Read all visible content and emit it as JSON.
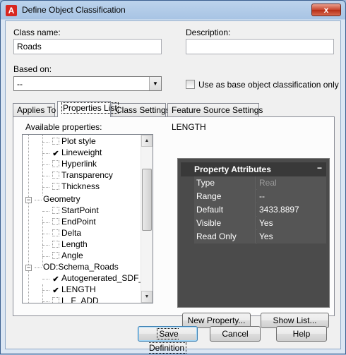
{
  "window": {
    "title": "Define Object Classification",
    "close_label": "x",
    "app_icon_letter": "A"
  },
  "form": {
    "class_name_label": "Class name:",
    "class_name_value": "Roads",
    "description_label": "Description:",
    "description_value": "",
    "based_on_label": "Based on:",
    "based_on_value": "--",
    "base_only_label": "Use as base object classification only",
    "base_only_checked": false
  },
  "tabs": [
    {
      "label": "Applies To",
      "active": false
    },
    {
      "label": "Properties List",
      "active": true
    },
    {
      "label": "Class Settings",
      "active": false
    },
    {
      "label": "Feature Source Settings",
      "active": false
    }
  ],
  "properties": {
    "available_label": "Available properties:",
    "selected_title": "LENGTH",
    "tree": [
      {
        "label": "Plot style",
        "type": "leaf",
        "checked": false
      },
      {
        "label": "Lineweight",
        "type": "leaf",
        "checked": true
      },
      {
        "label": "Hyperlink",
        "type": "leaf",
        "checked": false
      },
      {
        "label": "Transparency",
        "type": "leaf",
        "checked": false
      },
      {
        "label": "Thickness",
        "type": "leaf",
        "checked": false
      },
      {
        "label": "Geometry",
        "type": "group",
        "expand": "−"
      },
      {
        "label": "StartPoint",
        "type": "leaf",
        "checked": false
      },
      {
        "label": "EndPoint",
        "type": "leaf",
        "checked": false
      },
      {
        "label": "Delta",
        "type": "leaf",
        "checked": false
      },
      {
        "label": "Length",
        "type": "leaf",
        "checked": false
      },
      {
        "label": "Angle",
        "type": "leaf",
        "checked": false
      },
      {
        "label": "OD:Schema_Roads",
        "type": "group",
        "expand": "−"
      },
      {
        "label": "Autogenerated_SDF_ID",
        "type": "leaf",
        "checked": true
      },
      {
        "label": "LENGTH",
        "type": "leaf",
        "checked": true
      },
      {
        "label": "L_F_ADD",
        "type": "leaf",
        "checked": false
      }
    ],
    "attributes_header": "Property Attributes",
    "attributes_collapse": "−",
    "attributes": [
      {
        "name": "Type",
        "value": "Real",
        "dim": true
      },
      {
        "name": "Range",
        "value": "--",
        "dim": false
      },
      {
        "name": "Default",
        "value": "3433.8897",
        "dim": false
      },
      {
        "name": "Visible",
        "value": "Yes",
        "dim": false
      },
      {
        "name": "Read Only",
        "value": "Yes",
        "dim": false
      }
    ],
    "new_property_label": "New Property...",
    "show_list_label": "Show List..."
  },
  "footer": {
    "save_label": "Save Definition",
    "cancel_label": "Cancel",
    "help_label": "Help"
  },
  "scroll": {
    "up_glyph": "▲",
    "down_glyph": "▼"
  }
}
